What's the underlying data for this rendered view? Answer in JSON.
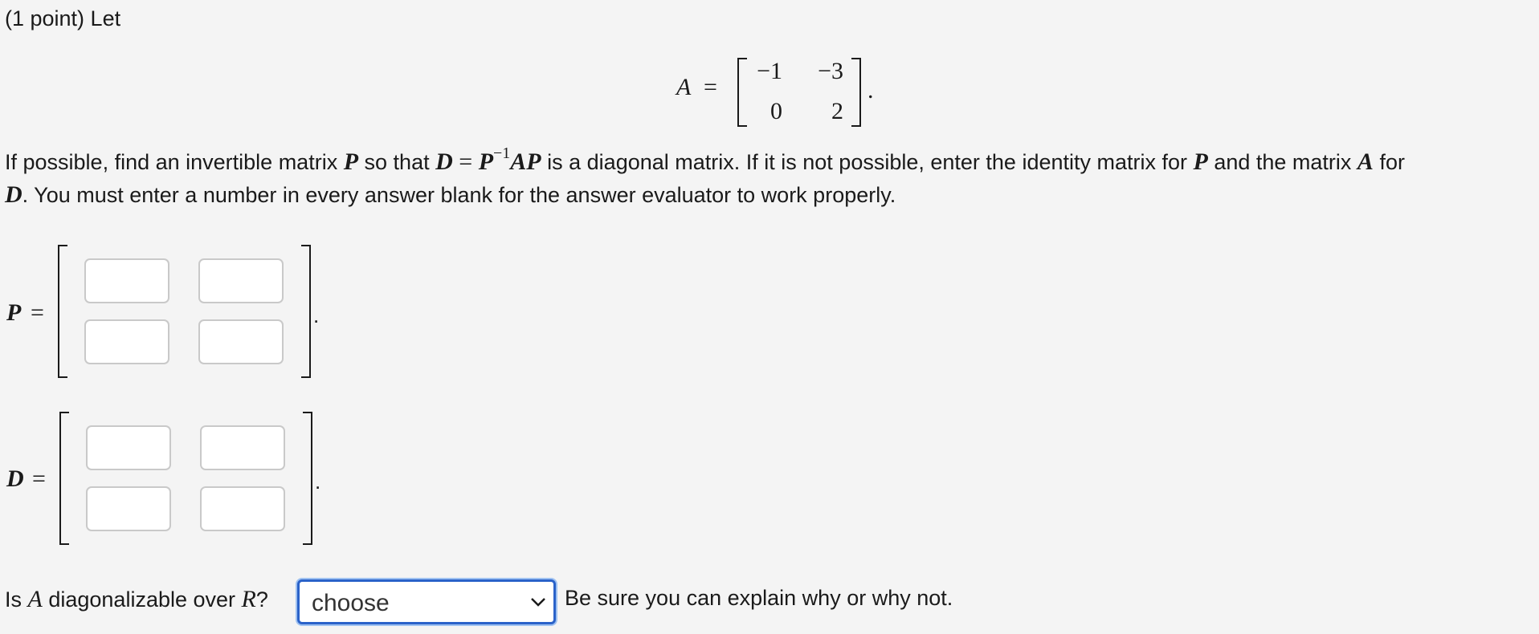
{
  "header": {
    "points": "(1 point) Let"
  },
  "matrix_A": {
    "name": "A",
    "equals": "=",
    "entries": [
      "−1",
      "−3",
      "0",
      "2"
    ],
    "period": "."
  },
  "instructions": {
    "line1_a": "If possible, find an invertible matrix ",
    "P": "P",
    "line1_b": " so that ",
    "D": "D",
    "eq": " = ",
    "P2": "P",
    "sup": "−1",
    "AP": "AP",
    "line1_c": " is a diagonal matrix. If it is not possible, enter the identity matrix for ",
    "P3": "P",
    "line1_d": " and the matrix ",
    "A": "A",
    "line1_e": " for",
    "D2": "D",
    "line2": ". You must enter a number in every answer blank for the answer evaluator to work properly."
  },
  "matrix_P": {
    "name": "P",
    "equals": "=",
    "period": "."
  },
  "matrix_D": {
    "name": "D",
    "equals": "=",
    "period": "."
  },
  "question": {
    "prefix": "Is ",
    "A": "A",
    "middle": " diagonalizable over ",
    "R": "R",
    "qmark": "?",
    "suffix": "Be sure you can explain why or why not."
  },
  "select": {
    "value": "choose"
  }
}
